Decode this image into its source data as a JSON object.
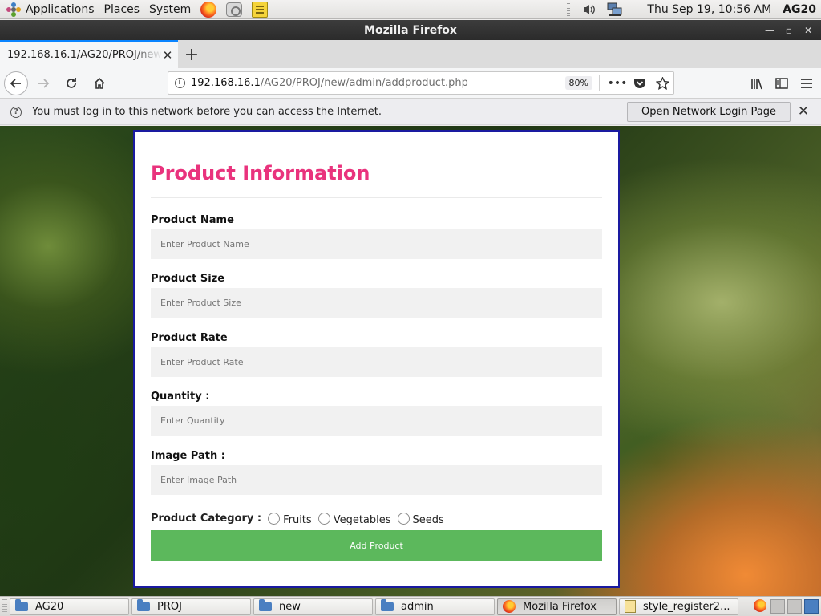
{
  "top_panel": {
    "applications": "Applications",
    "places": "Places",
    "system": "System",
    "clock": "Thu Sep 19, 10:56 AM",
    "host": "AG20"
  },
  "window": {
    "title": "Mozilla Firefox"
  },
  "browser": {
    "tab_title": "192.168.16.1/AG20/PROJ/new/admin/addproduct.php",
    "url_host": "192.168.16.1",
    "url_path": "/AG20/PROJ/new/admin/addproduct.php",
    "zoom": "80%"
  },
  "notification": {
    "message": "You must log in to this network before you can access the Internet.",
    "button_label": "Open Network Login Page"
  },
  "form": {
    "title": "Product Information",
    "fields": [
      {
        "label": "Product Name",
        "placeholder": "Enter Product Name"
      },
      {
        "label": "Product Size",
        "placeholder": "Enter Product Size"
      },
      {
        "label": "Product Rate",
        "placeholder": "Enter Product Rate"
      },
      {
        "label": "Quantity :",
        "placeholder": "Enter Quantity"
      },
      {
        "label": "Image Path :",
        "placeholder": "Enter Image Path"
      }
    ],
    "category_label": "Product Category :",
    "categories": [
      "Fruits",
      "Vegetables",
      "Seeds"
    ],
    "submit_label": "Add Product"
  },
  "taskbar": {
    "items": [
      "AG20",
      "PROJ",
      "new",
      "admin",
      "Mozilla Firefox",
      "style_register2..."
    ]
  },
  "colors": {
    "title_pink": "#e9337d",
    "submit_green": "#5cb85c",
    "card_border": "#1a1aa0"
  }
}
